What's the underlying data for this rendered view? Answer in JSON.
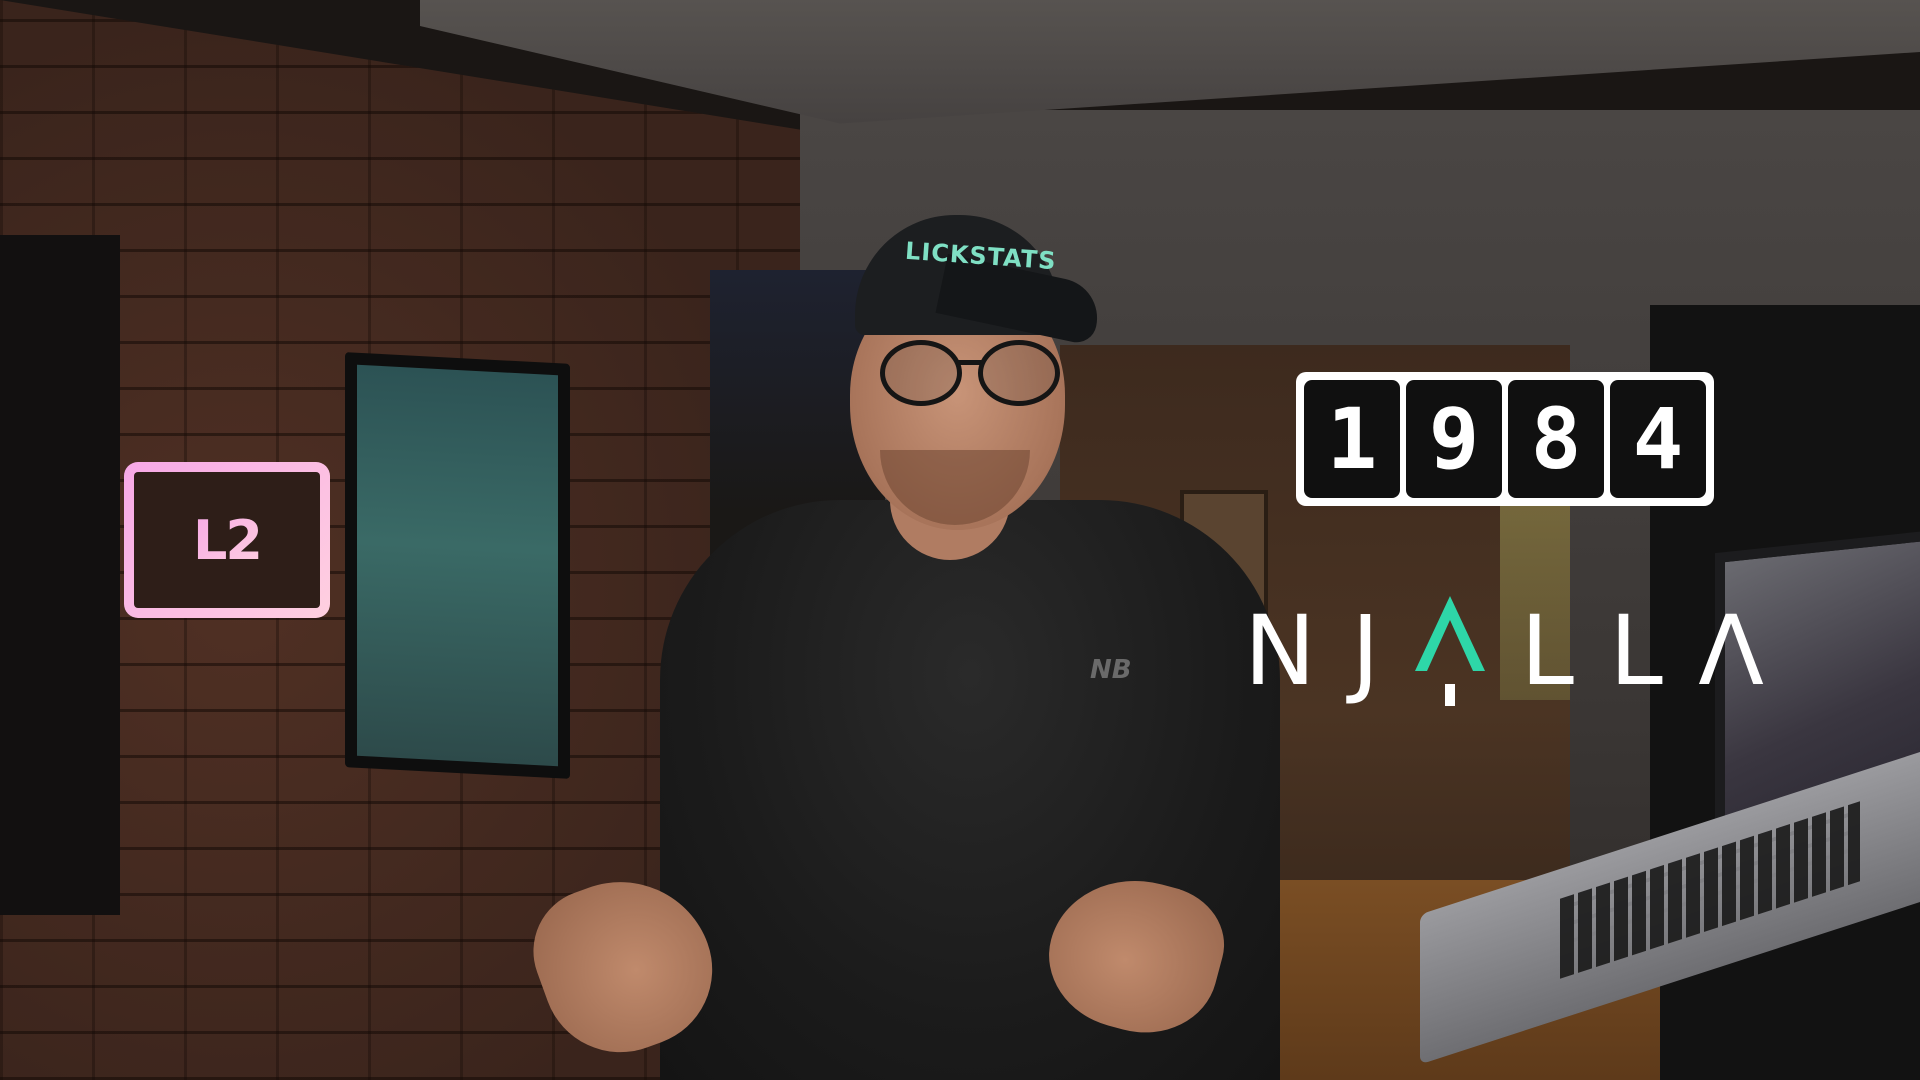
{
  "scene": {
    "cap_text": "LICKSTATS",
    "shirt_logo": "NB"
  },
  "overlays": {
    "l2": {
      "text": "L2",
      "colors": {
        "gradient_start": "#f7a8e6",
        "gradient_end": "#ffd0e0"
      }
    },
    "logo_1984": {
      "digits": [
        "1",
        "9",
        "8",
        "4"
      ],
      "colors": {
        "frame": "#ffffff",
        "tile": "#101010",
        "digit": "#ffffff"
      }
    },
    "njalla": {
      "letters": [
        "N",
        "J",
        "",
        "L",
        "L",
        "Λ"
      ],
      "accent_color": "#2ed6a8",
      "text_color": "#ffffff"
    }
  }
}
